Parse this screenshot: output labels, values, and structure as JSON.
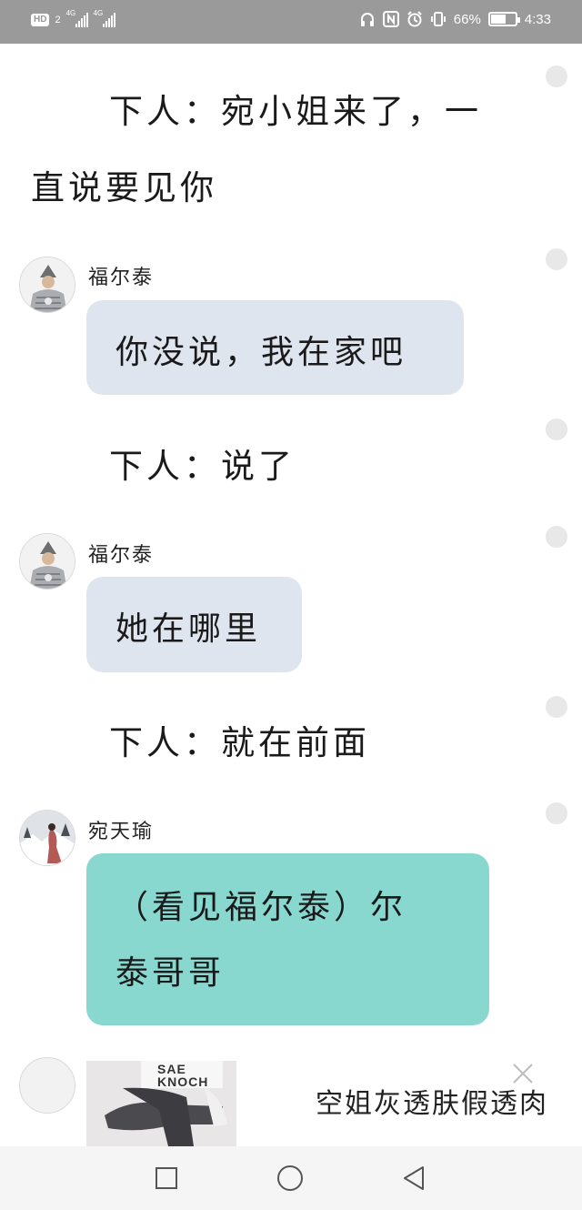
{
  "status_bar": {
    "hd_badge": "HD",
    "sim_slot": "2",
    "network_1": "4G",
    "network_2": "4G",
    "battery_percent": "66%",
    "battery_level": 0.66,
    "time": "4:33",
    "icons": [
      "headphones-icon",
      "nfc-icon",
      "alarm-icon",
      "vibrate-icon",
      "battery-icon"
    ]
  },
  "chat": {
    "narrations": [
      {
        "line1": "下人：宛小姐来了，一",
        "line2": "直说要见你"
      },
      {
        "line1": "下人：说了"
      },
      {
        "line1": "下人：就在前面"
      }
    ],
    "messages": [
      {
        "sender": "福尔泰",
        "text": "你没说，我在家吧"
      },
      {
        "sender": "福尔泰",
        "text": "她在哪里"
      },
      {
        "sender": "宛天瑜",
        "line1": "（看见福尔泰）尔",
        "line2": "泰哥哥"
      }
    ]
  },
  "ad": {
    "image_text": "SAE KNOCH",
    "headline": "空姐灰透肤假透肉"
  },
  "colors": {
    "status_bar": "#9a9a9a",
    "bubble_grey": "#dfe5ee",
    "bubble_teal": "#88d8d0",
    "nav_bar": "#f5f5f5"
  },
  "navbar": {
    "icons": [
      "recent-apps-icon",
      "home-icon",
      "back-icon"
    ]
  }
}
